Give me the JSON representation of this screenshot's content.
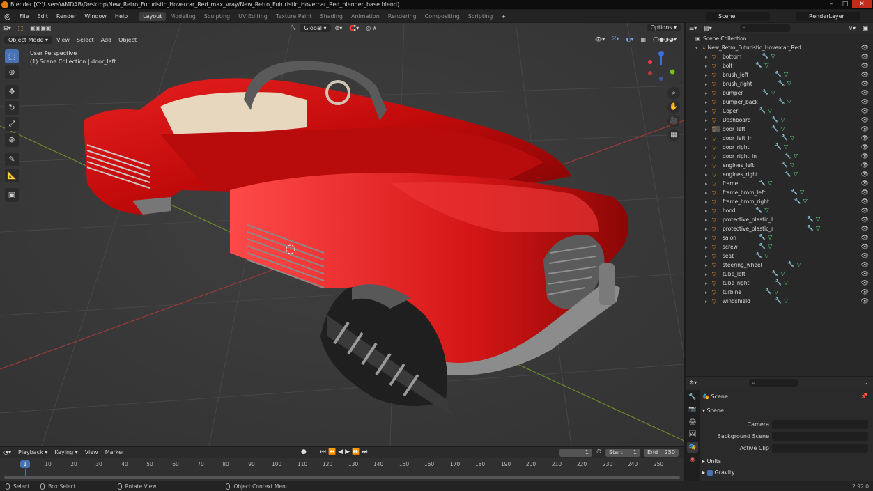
{
  "window": {
    "title": "Blender [C:\\Users\\AMDAB\\Desktop\\New_Retro_Futuristic_Hovercar_Red_max_vray/New_Retro_Futuristic_Hovercar_Red_blender_base.blend]"
  },
  "menu": [
    "File",
    "Edit",
    "Render",
    "Window",
    "Help"
  ],
  "workspaces": [
    "Layout",
    "Modeling",
    "Sculpting",
    "UV Editing",
    "Texture Paint",
    "Shading",
    "Animation",
    "Rendering",
    "Compositing",
    "Scripting"
  ],
  "active_workspace": "Layout",
  "scene_field": "Scene",
  "render_layer_field": "RenderLayer",
  "viewport": {
    "transform_orientation": "Global",
    "options_label": "Options",
    "mode": "Object Mode",
    "menus": [
      "View",
      "Select",
      "Add",
      "Object"
    ],
    "perspective_label": "User Perspective",
    "collection_label": "(1) Scene Collection | door_left"
  },
  "outliner": {
    "root": "Scene Collection",
    "collection": "New_Retro_Futuristic_Hovercar_Red",
    "objects": [
      "bottom",
      "bolt",
      "brush_left",
      "brush_right",
      "bumper",
      "bumper_back",
      "Coper",
      "Dashboard",
      "door_left",
      "door_left_in",
      "door_right",
      "door_right_in",
      "engines_left",
      "engines_right",
      "frame",
      "frame_hrom_left",
      "frame_hrom_right",
      "hood",
      "protective_plastic_l",
      "protective_plastic_r",
      "salon",
      "screw",
      "seat",
      "steering_wheel",
      "tube_left",
      "tube_right",
      "turbine",
      "windshield"
    ],
    "selected": "door_left"
  },
  "properties": {
    "context": "Scene",
    "panel_title": "Scene",
    "fields": [
      {
        "label": "Camera"
      },
      {
        "label": "Background Scene"
      },
      {
        "label": "Active Clip"
      }
    ],
    "subpanels": [
      "Units",
      "Gravity"
    ]
  },
  "timeline": {
    "menus": [
      "Playback",
      "Keying",
      "View",
      "Marker"
    ],
    "current_frame": "1",
    "start_label": "Start",
    "start_value": "1",
    "end_label": "End",
    "end_value": "250",
    "ticks": [
      "1",
      "10",
      "20",
      "30",
      "40",
      "50",
      "60",
      "70",
      "80",
      "90",
      "100",
      "110",
      "120",
      "130",
      "140",
      "150",
      "160",
      "170",
      "180",
      "190",
      "200",
      "210",
      "220",
      "230",
      "240",
      "250"
    ]
  },
  "statusbar": {
    "select": "Select",
    "box_select": "Box Select",
    "rotate_view": "Rotate View",
    "context_menu": "Object Context Menu",
    "version": "2.92.0"
  },
  "colors": {
    "accent": "#4772b3",
    "car_body": "#d01010",
    "object_icon": "#e38c2d"
  }
}
